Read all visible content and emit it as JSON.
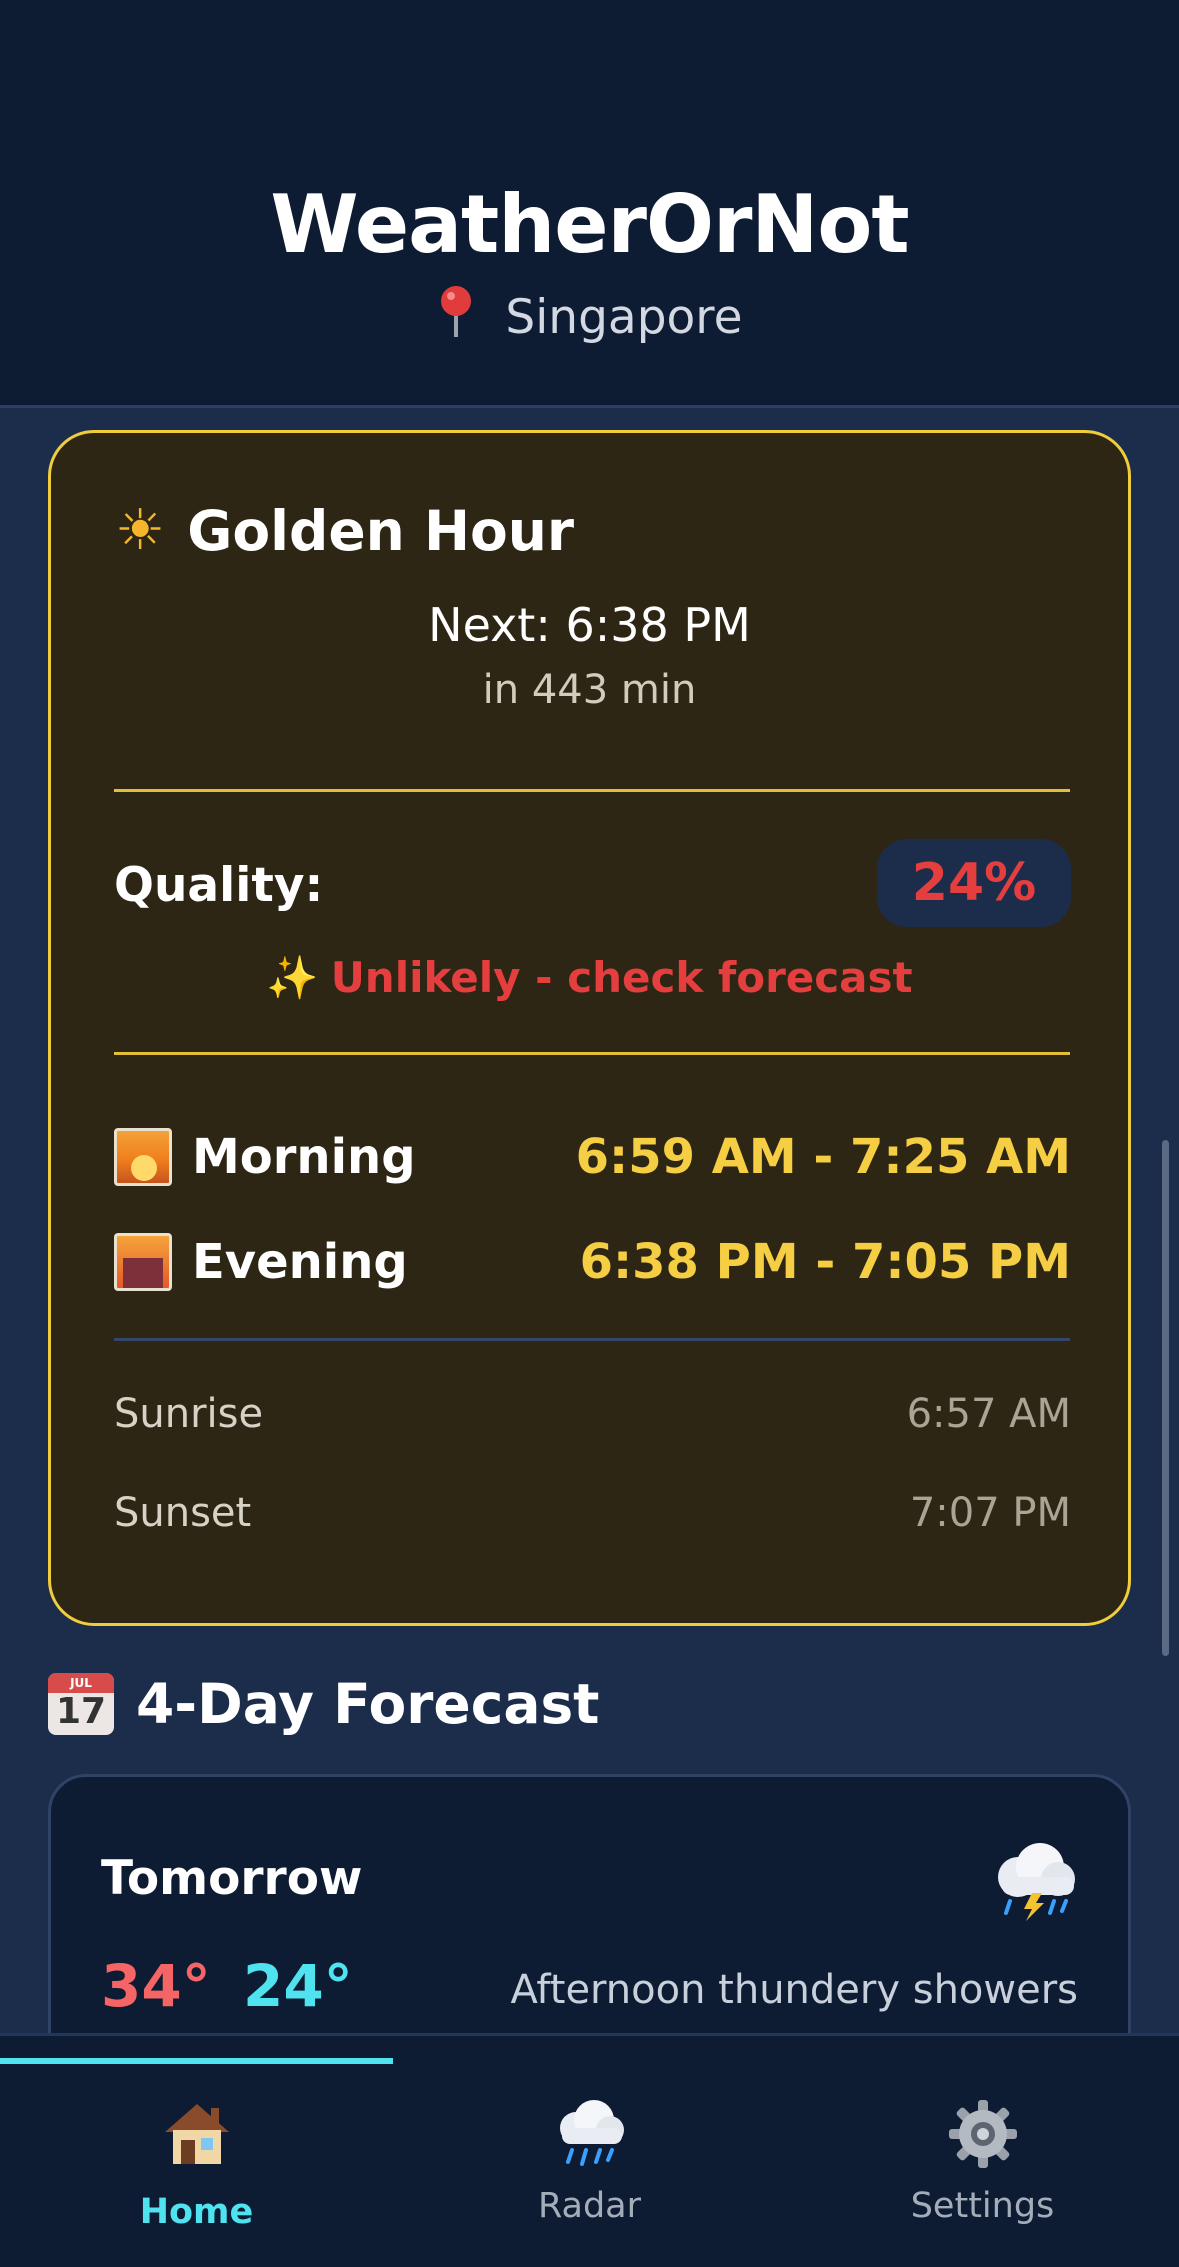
{
  "header": {
    "title": "WeatherOrNot",
    "location_icon": "pin-icon",
    "location": "Singapore"
  },
  "golden_hour": {
    "icon": "sun-icon",
    "title": "Golden Hour",
    "next": "Next: 6:38 PM",
    "countdown": "in 443 min",
    "quality_label": "Quality:",
    "quality_value": "24%",
    "quality_note": "Unlikely - check forecast",
    "quality_note_icon": "sparkles-icon",
    "periods": [
      {
        "icon": "sunrise-icon",
        "name": "Morning",
        "time": "6:59 AM - 7:25 AM"
      },
      {
        "icon": "city-sunset-icon",
        "name": "Evening",
        "time": "6:38 PM - 7:05 PM"
      }
    ],
    "sun_times": [
      {
        "label": "Sunrise",
        "value": "6:57 AM"
      },
      {
        "label": "Sunset",
        "value": "7:07 PM"
      }
    ]
  },
  "forecast": {
    "icon": "calendar-icon",
    "calendar_month": "JUL",
    "calendar_day": "17",
    "heading": "4-Day Forecast",
    "days": [
      {
        "day": "Tomorrow",
        "icon": "thunderstorm-icon",
        "high": "34°",
        "low": "24°",
        "description": "Afternoon thundery showers"
      }
    ]
  },
  "nav": {
    "items": [
      {
        "icon": "home-icon",
        "label": "Home",
        "active": true
      },
      {
        "icon": "rain-cloud-icon",
        "label": "Radar",
        "active": false
      },
      {
        "icon": "gear-icon",
        "label": "Settings",
        "active": false
      }
    ]
  },
  "colors": {
    "background": "#1c2d4c",
    "header": "#0e1c33",
    "gold": "#f0cd3a",
    "warning_red": "#e53e3e",
    "cyan_accent": "#4fe3f0"
  }
}
